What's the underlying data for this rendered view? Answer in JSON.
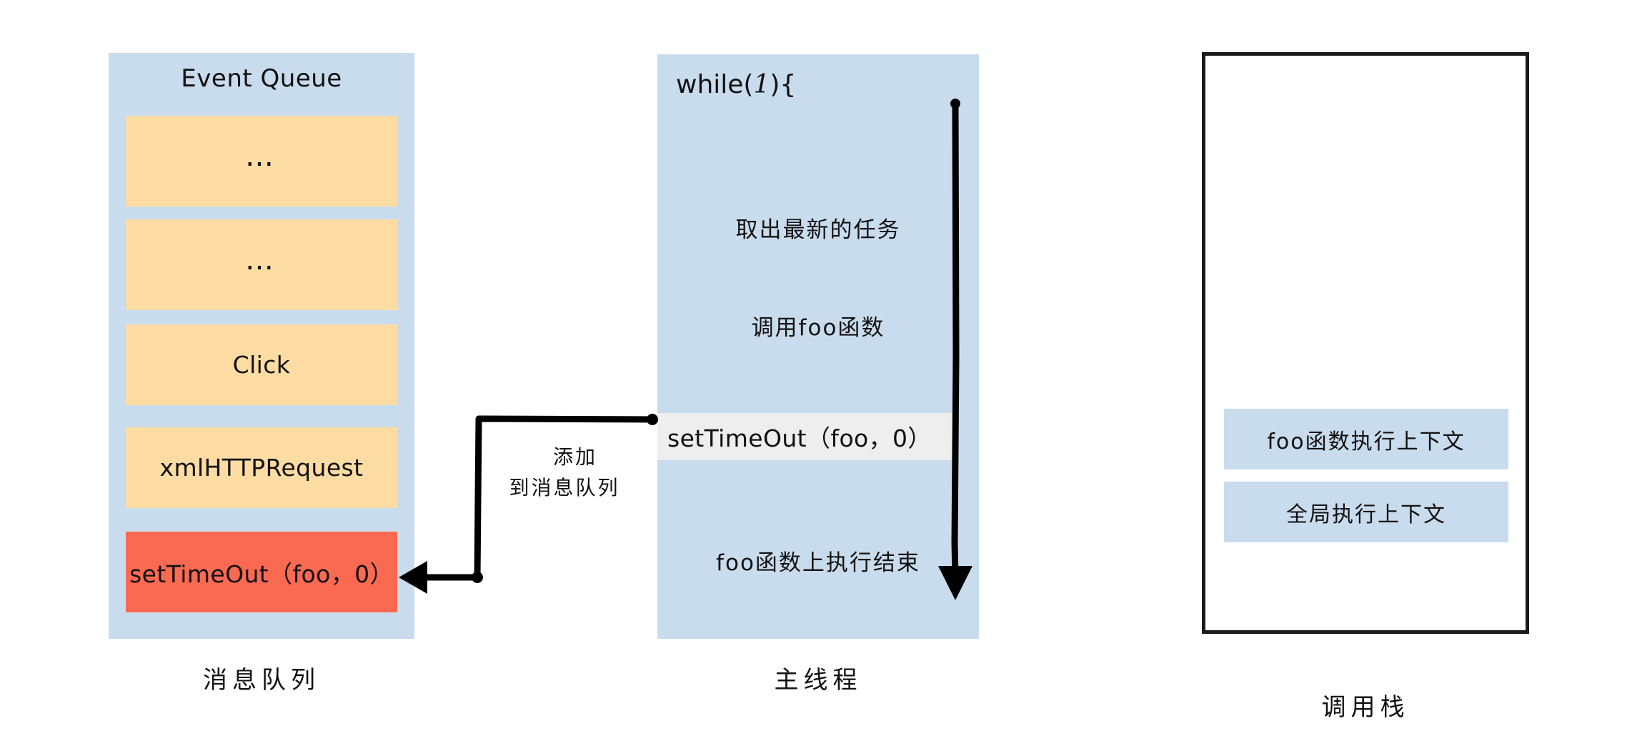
{
  "diagram": {
    "title": "JavaScript Event Loop Diagram",
    "colors": {
      "panel_blue": "#C9DCEE",
      "queue_item_orange": "#FDDCA3",
      "highlight_red": "#FA6A52",
      "call_stack_border": "#1A1A1A",
      "settimeout_call_gray": "#EEEEEE",
      "arrow_black": "#000000",
      "background": "#FFFFFF"
    }
  },
  "event_queue": {
    "title": "Event Queue",
    "caption": "消息队列",
    "items": [
      {
        "label": "…",
        "style": "dots"
      },
      {
        "label": "…",
        "style": "dots"
      },
      {
        "label": "Click",
        "style": "normal"
      },
      {
        "label": "xmlHTTPRequest",
        "style": "normal"
      },
      {
        "label": "setTimeOut（foo，0）",
        "style": "highlight"
      }
    ]
  },
  "main_thread": {
    "caption": "主线程",
    "loop_open": "while(",
    "loop_arg": "1",
    "loop_close": "){",
    "steps": [
      "取出最新的任务",
      "调用foo函数",
      "foo函数上执行结束"
    ],
    "settimeout_call": "setTimeOut（foo，0）"
  },
  "call_stack": {
    "caption": "调用栈",
    "frames": [
      "foo函数执行上下文",
      "全局执行上下文"
    ]
  },
  "connector": {
    "line1": "添加",
    "line2": "到消息队列"
  }
}
